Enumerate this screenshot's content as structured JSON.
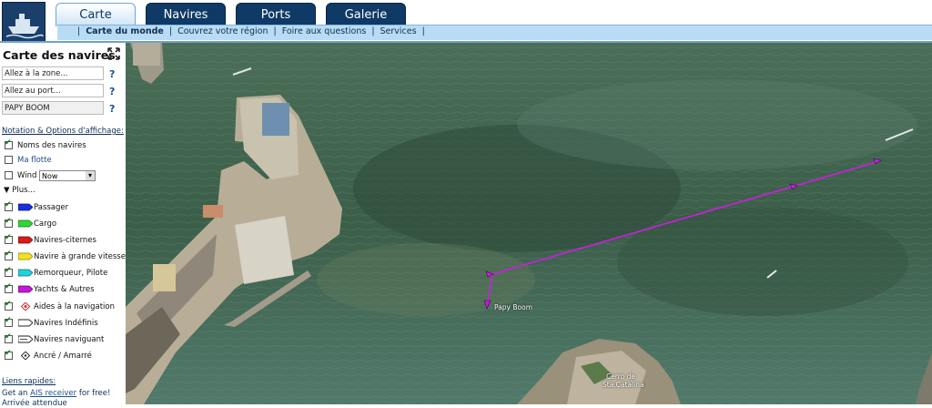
{
  "header": {
    "tabs": [
      {
        "label": "Carte",
        "active": true
      },
      {
        "label": "Navires",
        "active": false
      },
      {
        "label": "Ports",
        "active": false
      },
      {
        "label": "Galerie",
        "active": false
      }
    ],
    "subnav": [
      "Carte du monde",
      "Couvrez votre région",
      "Foire aux questions",
      "Services"
    ]
  },
  "sidebar": {
    "title": "Carte des navires",
    "zone_field": "Allez à la zone...",
    "port_field": "Allez au port...",
    "ship_field": "PAPY BOOM",
    "help": "?",
    "options_heading": "Notation & Options d'affichage:",
    "options": [
      {
        "label": "Noms des navires",
        "checked": true
      },
      {
        "label": "Ma flotte",
        "checked": false
      },
      {
        "label": "Wind",
        "checked": false
      }
    ],
    "wind_select": "Now",
    "plus": "Plus...",
    "legend": [
      {
        "label": "Passager",
        "color": "#1a2fd8",
        "checked": true
      },
      {
        "label": "Cargo",
        "color": "#2fd83a",
        "checked": true
      },
      {
        "label": "Navires-citernes",
        "color": "#d81a1a",
        "checked": true
      },
      {
        "label": "Navire à grande vitesse",
        "color": "#f2e21a",
        "checked": true
      },
      {
        "label": "Remorqueur, Pilote",
        "color": "#20d2d8",
        "checked": true
      },
      {
        "label": "Yachts & Autres",
        "color": "#c21ad8",
        "checked": true
      },
      {
        "label": "Aides à la navigation",
        "color": "#e05050",
        "checked": true
      },
      {
        "label": "Navires Indéfinis",
        "color": "#ffffff",
        "checked": true
      },
      {
        "label": "Navires naviguant",
        "color": "#ffffff",
        "checked": true
      },
      {
        "label": "Ancré / Amarré",
        "color": "#ffffff",
        "checked": true
      }
    ],
    "quick_heading": "Liens rapides:",
    "ais_prefix": "Get an ",
    "ais_link": "AIS receiver",
    "ais_suffix": " for free!",
    "extra": "Arrivée attendue"
  },
  "map": {
    "ship_label": "Papy Boom",
    "place_label": "Cerro de Sta.Catalina",
    "track_color": "#d21ae6"
  }
}
